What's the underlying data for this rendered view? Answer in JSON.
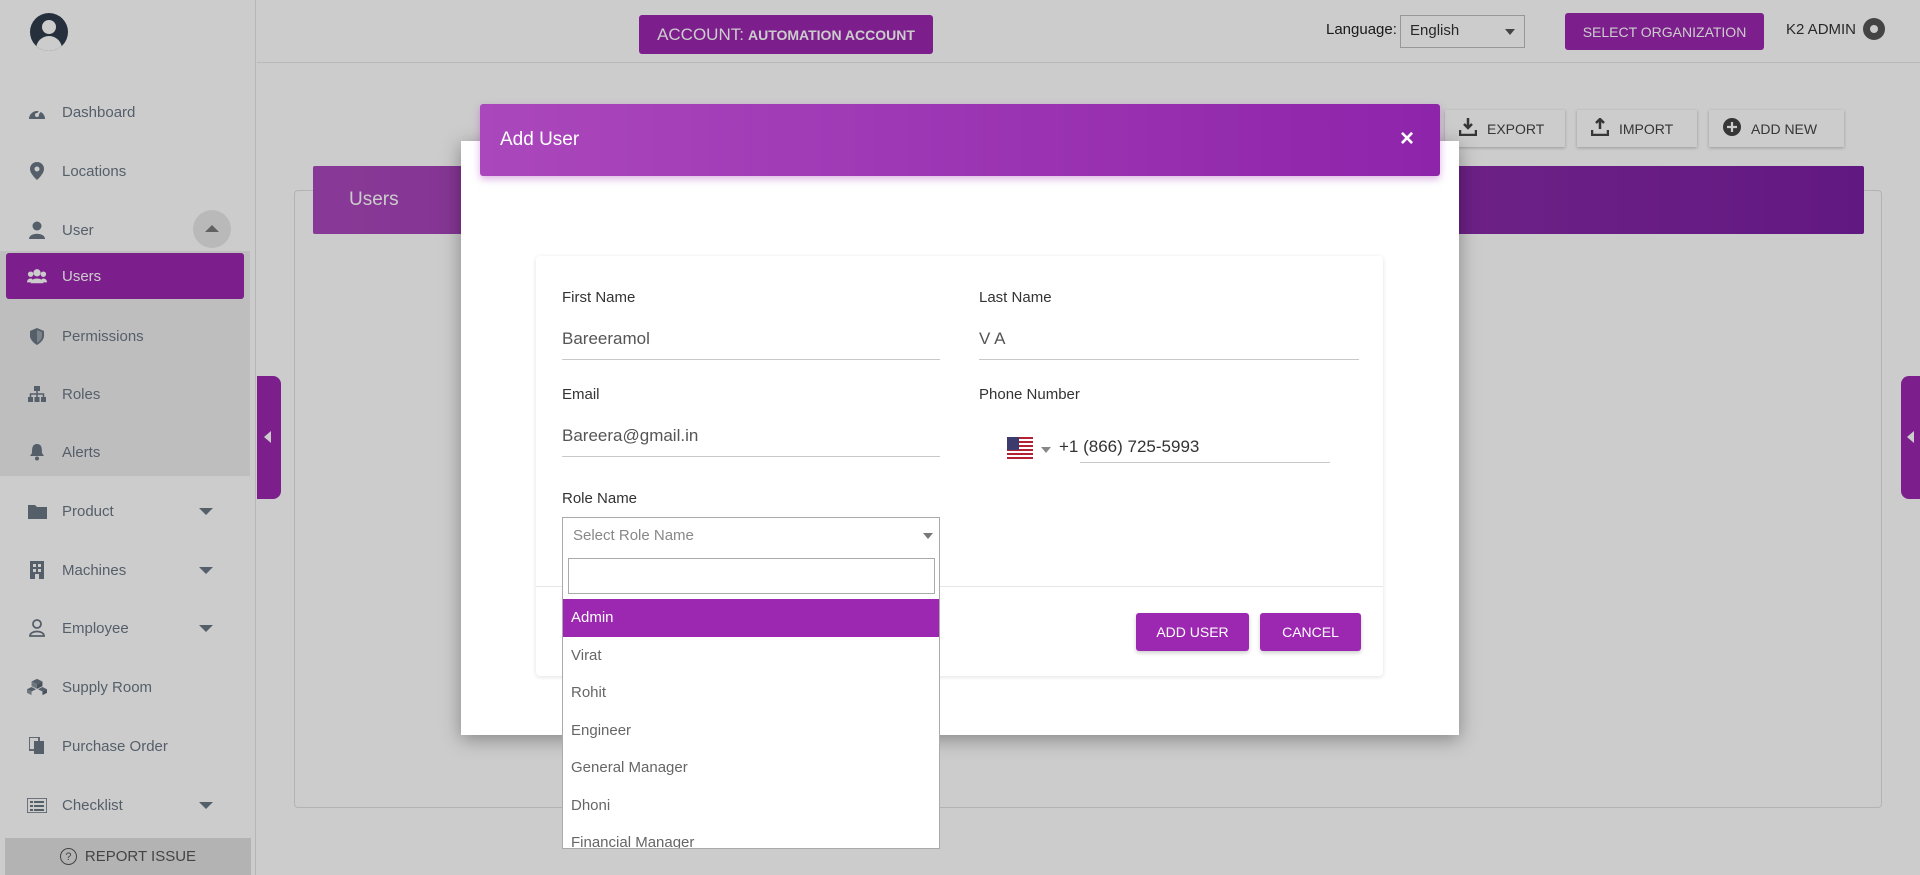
{
  "header": {
    "account_prefix": "ACCOUNT:",
    "account_name": "AUTOMATION ACCOUNT",
    "language_label": "Language:",
    "language_value": "English",
    "select_org_label": "SELECT ORGANIZATION",
    "user_name": "K2 ADMIN"
  },
  "sidebar": {
    "items": [
      {
        "label": "Dashboard",
        "icon": "dashboard-icon"
      },
      {
        "label": "Locations",
        "icon": "map-pin-icon"
      },
      {
        "label": "User",
        "icon": "user-icon"
      },
      {
        "label": "Users",
        "icon": "users-group-icon"
      },
      {
        "label": "Permissions",
        "icon": "shield-icon"
      },
      {
        "label": "Roles",
        "icon": "sitemap-icon"
      },
      {
        "label": "Alerts",
        "icon": "bell-icon"
      },
      {
        "label": "Product",
        "icon": "folder-icon"
      },
      {
        "label": "Machines",
        "icon": "building-icon"
      },
      {
        "label": "Employee",
        "icon": "person-outline-icon"
      },
      {
        "label": "Supply Room",
        "icon": "boxes-icon"
      },
      {
        "label": "Purchase Order",
        "icon": "copy-document-icon"
      },
      {
        "label": "Checklist",
        "icon": "list-icon"
      }
    ],
    "report_issue": "REPORT ISSUE"
  },
  "toolbar": {
    "export_label": "EXPORT",
    "import_label": "IMPORT",
    "add_new_label": "ADD NEW"
  },
  "page": {
    "section_title": "Users"
  },
  "modal": {
    "title": "Add User",
    "close_symbol": "×",
    "first_name_label": "First Name",
    "first_name_value": "Bareeramol",
    "last_name_label": "Last Name",
    "last_name_value": "V A",
    "email_label": "Email",
    "email_value": "Bareera@gmail.in",
    "phone_label": "Phone Number",
    "phone_value": "+1 (866) 725-5993",
    "role_label": "Role Name",
    "role_placeholder": "Select Role Name",
    "add_button": "ADD USER",
    "cancel_button": "CANCEL"
  },
  "role_dropdown": {
    "search_value": "",
    "options": [
      "Admin",
      "Virat",
      "Rohit",
      "Engineer",
      "General Manager",
      "Dhoni",
      "Financial Manager"
    ],
    "highlighted": "Admin"
  },
  "colors": {
    "accent": "#9c27b0",
    "overlay": "rgba(0,0,0,0.2)"
  }
}
